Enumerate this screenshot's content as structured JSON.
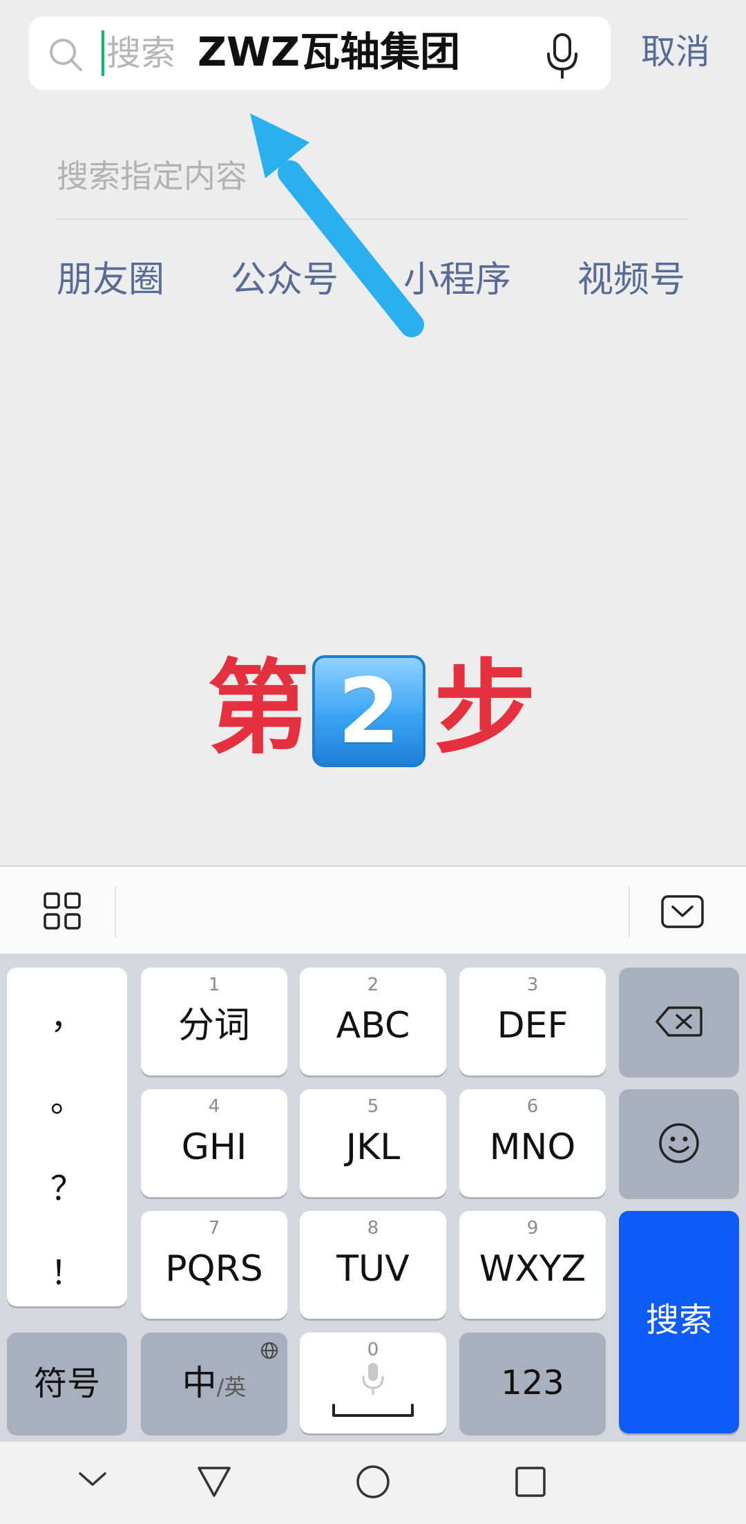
{
  "search": {
    "placeholder": "搜索",
    "overlay_text": "ZWZ瓦轴集团",
    "cancel_label": "取消"
  },
  "hint": "搜索指定内容",
  "categories": [
    "朋友圈",
    "公众号",
    "小程序",
    "视频号"
  ],
  "annotation": {
    "step_prefix": "第",
    "step_number": "2",
    "step_suffix": "步",
    "step_color": "#e5313f",
    "arrow_color": "#2bb0ef"
  },
  "keyboard": {
    "punctuation": [
      "，",
      "。",
      "？",
      "！"
    ],
    "keys": [
      {
        "num": "1",
        "label": "分词"
      },
      {
        "num": "2",
        "label": "ABC"
      },
      {
        "num": "3",
        "label": "DEF"
      },
      {
        "num": "4",
        "label": "GHI"
      },
      {
        "num": "5",
        "label": "JKL"
      },
      {
        "num": "6",
        "label": "MNO"
      },
      {
        "num": "7",
        "label": "PQRS"
      },
      {
        "num": "8",
        "label": "TUV"
      },
      {
        "num": "9",
        "label": "WXYZ"
      }
    ],
    "symbol_label": "符号",
    "lang_main": "中",
    "lang_alt": "/英",
    "space_num": "0",
    "numbers_label": "123",
    "search_label": "搜索",
    "search_key_color": "#0d5cf5"
  },
  "icons": {
    "search": "search-icon",
    "mic": "microphone-icon",
    "grid": "grid-icon",
    "collapse": "keyboard-collapse-icon",
    "backspace": "backspace-icon",
    "emoji": "emoji-icon",
    "globe": "globe-icon",
    "nav_down": "chevron-down-icon",
    "nav_back": "back-triangle-icon",
    "nav_home": "home-circle-icon",
    "nav_recent": "recent-square-icon"
  }
}
